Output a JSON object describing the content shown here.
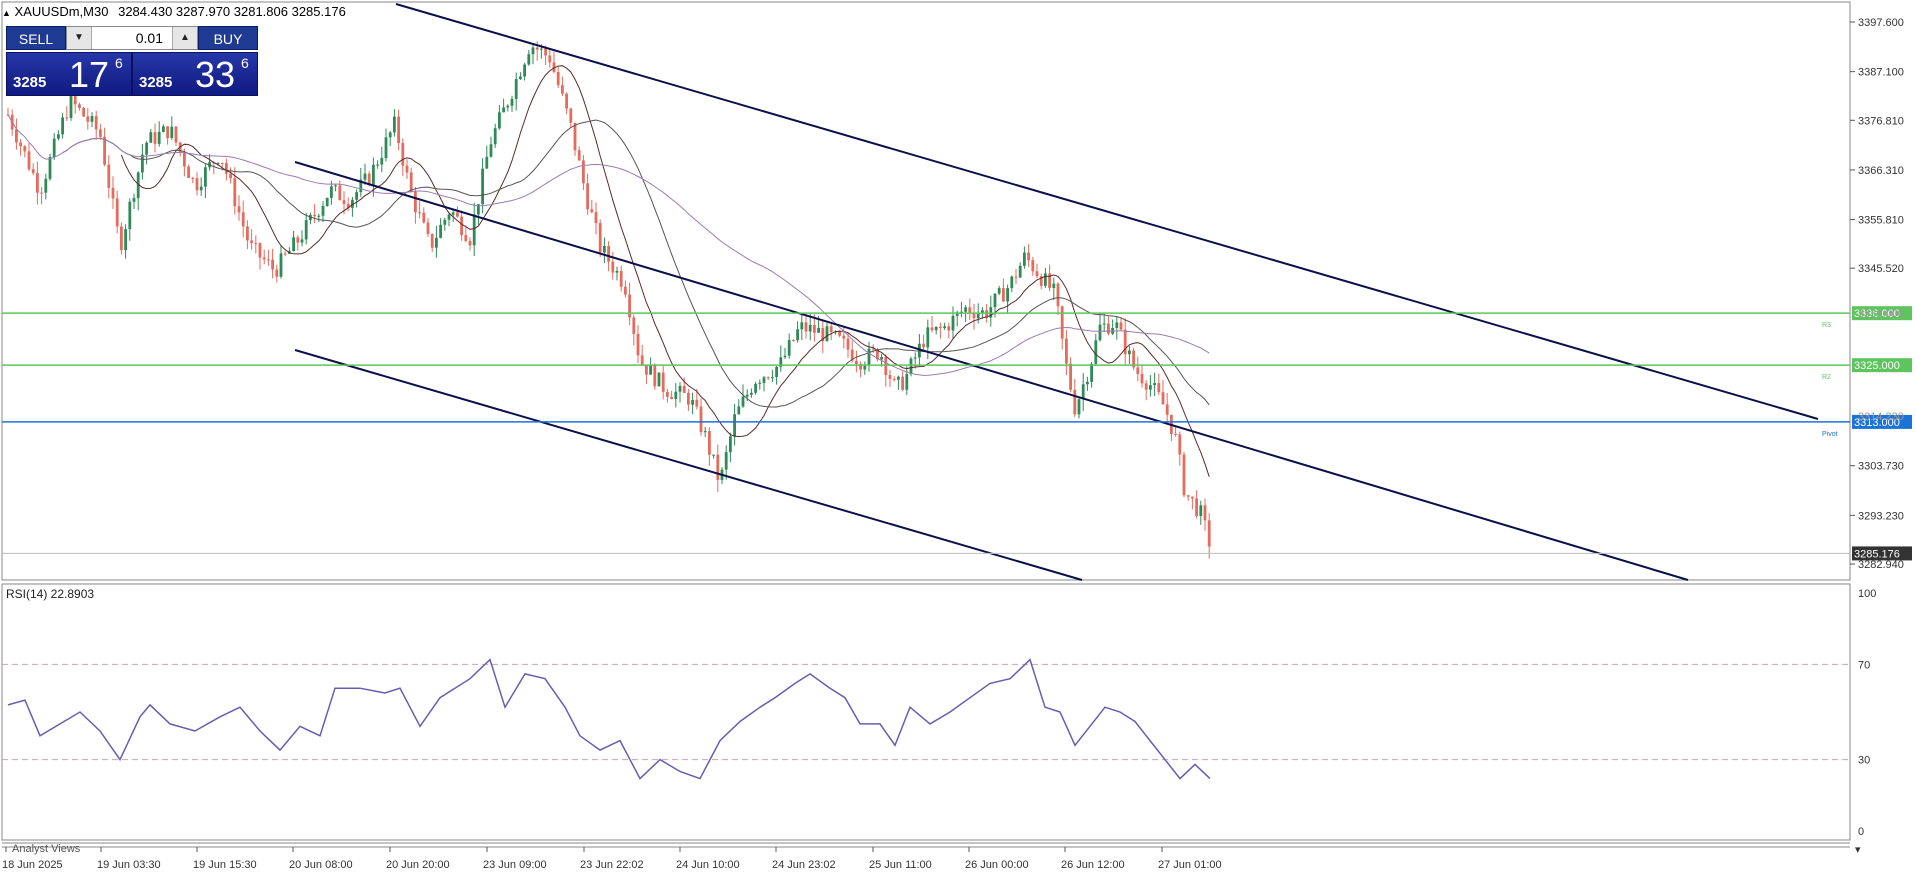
{
  "header": {
    "symbol_label": "XAUUSDm,M30",
    "ohlc": "3284.430 3287.970 3281.806 3285.176"
  },
  "trade_panel": {
    "sell_label": "SELL",
    "buy_label": "BUY",
    "lot_value": "0.01",
    "sell_price_prefix": "3285",
    "sell_price_big": "17",
    "sell_price_sup": "6",
    "buy_price_prefix": "3285",
    "buy_price_big": "33",
    "buy_price_sup": "6"
  },
  "price_axis": {
    "labels": [
      "3397.600",
      "3387.100",
      "3376.810",
      "3366.310",
      "3355.810",
      "3345.520",
      "3303.730",
      "3293.230",
      "3282.940"
    ],
    "partial_labels": [
      "3336.000",
      "3314.230"
    ]
  },
  "levels": [
    {
      "price": "3336.000",
      "name": "R3",
      "color": "#5ec45e"
    },
    {
      "price": "3325.000",
      "name": "R2",
      "color": "#5ec45e"
    },
    {
      "price": "3313.000",
      "name": "Pivot",
      "color": "#1a73d9"
    }
  ],
  "current_price": "3285.176",
  "rsi": {
    "label": "RSI(14) 22.8903",
    "levels": [
      "100",
      "70",
      "30",
      "0"
    ]
  },
  "time_axis": {
    "labels": [
      "18 Jun 2025",
      "19 Jun 03:30",
      "19 Jun 15:30",
      "20 Jun 08:00",
      "20 Jun 20:00",
      "23 Jun 09:00",
      "23 Jun 22:02",
      "24 Jun 10:00",
      "24 Jun 23:02",
      "25 Jun 11:00",
      "26 Jun 00:00",
      "26 Jun 12:00",
      "27 Jun 01:00"
    ]
  },
  "bottom_tab": "Analyst Views",
  "colors": {
    "bull": "#2e8b57",
    "bear": "#e56b5d",
    "channel": "#0b0f4a",
    "rsi": "#6b5bb0"
  }
}
